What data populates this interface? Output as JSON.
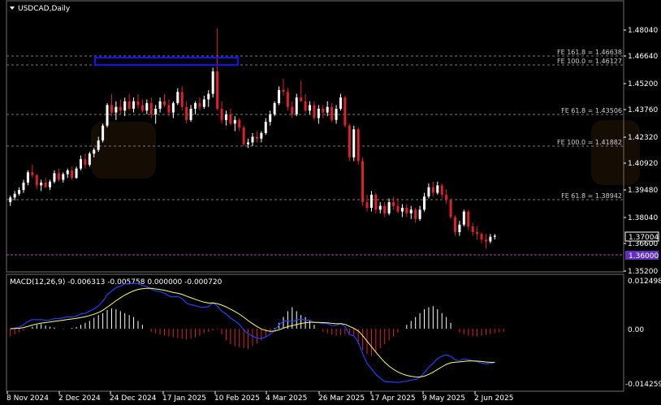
{
  "window": {
    "title": "USDCAD,Daily",
    "menu_icon": "triangle-down-icon"
  },
  "colors": {
    "background": "#000000",
    "bull": "#ffffff",
    "bear": "#e0202a",
    "grid": "#7a7a7a",
    "macd_main": "#2040ff",
    "macd_signal": "#ffff66",
    "rect": "#1010ff",
    "support_line": "#c040c0",
    "price_tag_bg": "#2020ff"
  },
  "price_axis": {
    "labels": [
      "1.48040",
      "1.46640",
      "1.45200",
      "1.43760",
      "1.42320",
      "1.40920",
      "1.39480",
      "1.38040",
      "1.36600",
      "1.35200"
    ],
    "current_price": "1.37004",
    "support_price": "1.36000"
  },
  "macd_axis": {
    "labels": [
      "0.012498",
      "0.00",
      "-0.014259"
    ]
  },
  "macd_header": "MACD(12,26,9) -0.006313 -0.005758 0.000000 -0.000720",
  "fe_levels": [
    {
      "label": "FE 161.8 = 1.46638",
      "price": 1.46638
    },
    {
      "label": "FE 100.0 = 1.46127",
      "price": 1.46127
    },
    {
      "label": "FE 61.8 = 1.43506",
      "price": 1.43506
    },
    {
      "label": "FE 100.0 = 1.41882",
      "price": 1.41882
    },
    {
      "label": "FE 61.8 = 1.38942",
      "price": 1.38942
    }
  ],
  "time_axis": {
    "labels": [
      "8 Nov 2024",
      "2 Dec 2024",
      "24 Dec 2024",
      "17 Jan 2025",
      "10 Feb 2025",
      "4 Mar 2025",
      "26 Mar 2025",
      "17 Apr 2025",
      "9 May 2025",
      "2 Jun 2025"
    ]
  },
  "chart_data": {
    "type": "candlestick",
    "symbol": "USDCAD",
    "timeframe": "Daily",
    "ylim": [
      1.35,
      1.487
    ],
    "candles": [
      [
        1.388,
        1.3915,
        1.386,
        1.3905
      ],
      [
        1.3905,
        1.394,
        1.389,
        1.3925
      ],
      [
        1.3925,
        1.396,
        1.3915,
        1.3945
      ],
      [
        1.3945,
        1.4,
        1.393,
        1.3985
      ],
      [
        1.3985,
        1.405,
        1.397,
        1.404
      ],
      [
        1.404,
        1.408,
        1.401,
        1.4025
      ],
      [
        1.4025,
        1.403,
        1.395,
        1.397
      ],
      [
        1.397,
        1.4,
        1.394,
        1.3985
      ],
      [
        1.3985,
        1.401,
        1.3955,
        1.396
      ],
      [
        1.396,
        1.4,
        1.3945,
        1.399
      ],
      [
        1.399,
        1.405,
        1.398,
        1.4035
      ],
      [
        1.4035,
        1.406,
        1.399,
        1.4
      ],
      [
        1.4,
        1.404,
        1.3985,
        1.403
      ],
      [
        1.403,
        1.406,
        1.401,
        1.405
      ],
      [
        1.405,
        1.407,
        1.4,
        1.401
      ],
      [
        1.401,
        1.407,
        1.4005,
        1.406
      ],
      [
        1.406,
        1.413,
        1.405,
        1.411
      ],
      [
        1.411,
        1.414,
        1.406,
        1.408
      ],
      [
        1.408,
        1.415,
        1.407,
        1.414
      ],
      [
        1.414,
        1.417,
        1.412,
        1.416
      ],
      [
        1.416,
        1.423,
        1.415,
        1.421
      ],
      [
        1.421,
        1.43,
        1.42,
        1.429
      ],
      [
        1.429,
        1.441,
        1.428,
        1.44
      ],
      [
        1.44,
        1.446,
        1.434,
        1.436
      ],
      [
        1.436,
        1.442,
        1.432,
        1.439
      ],
      [
        1.439,
        1.443,
        1.435,
        1.437
      ],
      [
        1.437,
        1.444,
        1.434,
        1.442
      ],
      [
        1.442,
        1.446,
        1.437,
        1.438
      ],
      [
        1.438,
        1.444,
        1.436,
        1.442
      ],
      [
        1.442,
        1.446,
        1.438,
        1.44
      ],
      [
        1.44,
        1.443,
        1.436,
        1.437
      ],
      [
        1.437,
        1.443,
        1.435,
        1.441
      ],
      [
        1.441,
        1.444,
        1.433,
        1.435
      ],
      [
        1.435,
        1.44,
        1.43,
        1.438
      ],
      [
        1.438,
        1.444,
        1.436,
        1.442
      ],
      [
        1.442,
        1.446,
        1.439,
        1.44
      ],
      [
        1.44,
        1.443,
        1.434,
        1.436
      ],
      [
        1.436,
        1.442,
        1.433,
        1.441
      ],
      [
        1.441,
        1.449,
        1.44,
        1.447
      ],
      [
        1.447,
        1.45,
        1.437,
        1.439
      ],
      [
        1.439,
        1.442,
        1.43,
        1.432
      ],
      [
        1.432,
        1.44,
        1.431,
        1.438
      ],
      [
        1.438,
        1.442,
        1.435,
        1.441
      ],
      [
        1.441,
        1.444,
        1.437,
        1.439
      ],
      [
        1.439,
        1.445,
        1.438,
        1.443
      ],
      [
        1.443,
        1.448,
        1.439,
        1.446
      ],
      [
        1.446,
        1.46,
        1.444,
        1.458
      ],
      [
        1.458,
        1.481,
        1.437,
        1.438
      ],
      [
        1.438,
        1.442,
        1.43,
        1.432
      ],
      [
        1.432,
        1.437,
        1.429,
        1.435
      ],
      [
        1.435,
        1.438,
        1.429,
        1.43
      ],
      [
        1.43,
        1.434,
        1.426,
        1.432
      ],
      [
        1.432,
        1.433,
        1.426,
        1.428
      ],
      [
        1.428,
        1.429,
        1.418,
        1.419
      ],
      [
        1.419,
        1.422,
        1.417,
        1.42
      ],
      [
        1.42,
        1.425,
        1.418,
        1.423
      ],
      [
        1.423,
        1.426,
        1.42,
        1.422
      ],
      [
        1.422,
        1.426,
        1.42,
        1.425
      ],
      [
        1.425,
        1.433,
        1.424,
        1.431
      ],
      [
        1.431,
        1.437,
        1.429,
        1.435
      ],
      [
        1.435,
        1.442,
        1.434,
        1.441
      ],
      [
        1.441,
        1.45,
        1.44,
        1.448
      ],
      [
        1.448,
        1.454,
        1.445,
        1.447
      ],
      [
        1.447,
        1.449,
        1.437,
        1.439
      ],
      [
        1.439,
        1.442,
        1.433,
        1.435
      ],
      [
        1.435,
        1.446,
        1.434,
        1.444
      ],
      [
        1.444,
        1.453,
        1.442,
        1.442
      ],
      [
        1.442,
        1.446,
        1.436,
        1.437
      ],
      [
        1.437,
        1.442,
        1.435,
        1.44
      ],
      [
        1.44,
        1.442,
        1.432,
        1.433
      ],
      [
        1.433,
        1.44,
        1.43,
        1.438
      ],
      [
        1.438,
        1.44,
        1.433,
        1.436
      ],
      [
        1.436,
        1.442,
        1.434,
        1.439
      ],
      [
        1.439,
        1.441,
        1.431,
        1.432
      ],
      [
        1.432,
        1.44,
        1.43,
        1.438
      ],
      [
        1.438,
        1.446,
        1.437,
        1.444
      ],
      [
        1.444,
        1.445,
        1.428,
        1.429
      ],
      [
        1.429,
        1.43,
        1.41,
        1.412
      ],
      [
        1.412,
        1.429,
        1.41,
        1.427
      ],
      [
        1.427,
        1.428,
        1.408,
        1.41
      ],
      [
        1.41,
        1.412,
        1.386,
        1.388
      ],
      [
        1.388,
        1.392,
        1.383,
        1.385
      ],
      [
        1.385,
        1.394,
        1.383,
        1.392
      ],
      [
        1.392,
        1.393,
        1.382,
        1.384
      ],
      [
        1.384,
        1.388,
        1.382,
        1.386
      ],
      [
        1.386,
        1.388,
        1.38,
        1.382
      ],
      [
        1.382,
        1.39,
        1.381,
        1.388
      ],
      [
        1.388,
        1.391,
        1.384,
        1.386
      ],
      [
        1.386,
        1.39,
        1.382,
        1.383
      ],
      [
        1.383,
        1.387,
        1.38,
        1.385
      ],
      [
        1.385,
        1.387,
        1.38,
        1.382
      ],
      [
        1.382,
        1.386,
        1.379,
        1.384
      ],
      [
        1.384,
        1.385,
        1.377,
        1.379
      ],
      [
        1.379,
        1.386,
        1.378,
        1.384
      ],
      [
        1.384,
        1.393,
        1.383,
        1.391
      ],
      [
        1.391,
        1.398,
        1.39,
        1.396
      ],
      [
        1.396,
        1.399,
        1.391,
        1.393
      ],
      [
        1.393,
        1.399,
        1.392,
        1.397
      ],
      [
        1.397,
        1.398,
        1.39,
        1.392
      ],
      [
        1.392,
        1.395,
        1.387,
        1.389
      ],
      [
        1.389,
        1.39,
        1.379,
        1.38
      ],
      [
        1.38,
        1.381,
        1.37,
        1.372
      ],
      [
        1.372,
        1.378,
        1.37,
        1.376
      ],
      [
        1.376,
        1.384,
        1.375,
        1.383
      ],
      [
        1.383,
        1.384,
        1.373,
        1.375
      ],
      [
        1.375,
        1.377,
        1.37,
        1.372
      ],
      [
        1.372,
        1.375,
        1.368,
        1.371
      ],
      [
        1.371,
        1.372,
        1.366,
        1.368
      ],
      [
        1.368,
        1.371,
        1.363,
        1.367
      ],
      [
        1.367,
        1.371,
        1.366,
        1.3695
      ],
      [
        1.3695,
        1.371,
        1.368,
        1.37
      ]
    ],
    "macd_histogram": [
      -0.002,
      -0.0015,
      -0.001,
      -0.0005,
      0.0,
      0.0005,
      0.001,
      0.0012,
      0.0008,
      0.0005,
      0.0003,
      0.0,
      -0.0002,
      0.0,
      0.0002,
      0.0004,
      0.001,
      0.0015,
      0.002,
      0.0028,
      0.0035,
      0.004,
      0.0048,
      0.0052,
      0.005,
      0.0045,
      0.004,
      0.0035,
      0.003,
      0.002,
      0.001,
      0.0,
      -0.0008,
      -0.0012,
      -0.0015,
      -0.0018,
      -0.002,
      -0.0022,
      -0.0024,
      -0.0026,
      -0.0028,
      -0.0025,
      -0.0022,
      -0.0018,
      -0.0012,
      -0.0008,
      -0.0004,
      -0.0002,
      -0.0015,
      -0.003,
      -0.004,
      -0.0045,
      -0.0048,
      -0.005,
      -0.0052,
      -0.0045,
      -0.0038,
      -0.003,
      -0.002,
      -0.001,
      0.0002,
      0.0015,
      0.003,
      0.0045,
      0.0055,
      0.0045,
      0.0035,
      0.003,
      0.002,
      0.001,
      0.0,
      -0.0008,
      -0.0012,
      -0.0015,
      -0.0018,
      -0.0016,
      -0.0014,
      -0.0012,
      -0.002,
      -0.004,
      -0.0055,
      -0.0065,
      -0.007,
      -0.006,
      -0.005,
      -0.004,
      -0.003,
      -0.002,
      -0.001,
      0.0,
      0.001,
      0.002,
      0.003,
      0.004,
      0.005,
      0.0055,
      0.0058,
      0.005,
      0.004,
      0.003,
      0.0015,
      0.0,
      -0.001,
      -0.0015,
      -0.0018,
      -0.002,
      -0.002,
      -0.0018,
      -0.0016,
      -0.0014,
      -0.0012,
      -0.001,
      -0.0008
    ]
  }
}
